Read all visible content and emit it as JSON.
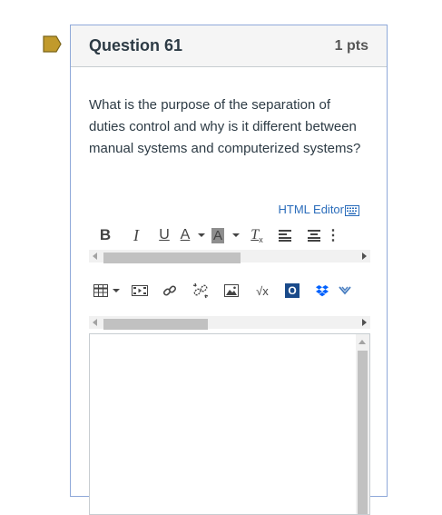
{
  "question": {
    "title": "Question 61",
    "points": "1 pts",
    "text": "What is the purpose of the separation of duties control and why is it different between manual systems and computerized systems?"
  },
  "editor": {
    "html_editor_label": "HTML Editor",
    "toolbar1": [
      "bold-icon",
      "italic-icon",
      "underline-icon",
      "font-color-icon",
      "background-color-icon",
      "clear-formatting-icon",
      "align-left-icon",
      "align-center-icon",
      "more-icon"
    ],
    "toolbar1_glyphs": {
      "bold": "B",
      "italic": "I",
      "underline": "U",
      "font_color": "A",
      "background_color": "A",
      "clear_formatting": "T",
      "more": "⋮"
    },
    "toolbar2": [
      "table-icon",
      "media-icon",
      "link-icon",
      "unlink-icon",
      "image-icon",
      "equation-icon",
      "office-icon",
      "dropbox-icon",
      "chevron-icon"
    ],
    "toolbar2_glyphs": {
      "equation": "√x",
      "office": "O"
    },
    "scroll1_fraction": 0.55,
    "scroll2_fraction": 0.42
  },
  "colors": {
    "accent": "#2b6dbb",
    "flag": "#c19a2c",
    "border": "#8fa9d9"
  }
}
